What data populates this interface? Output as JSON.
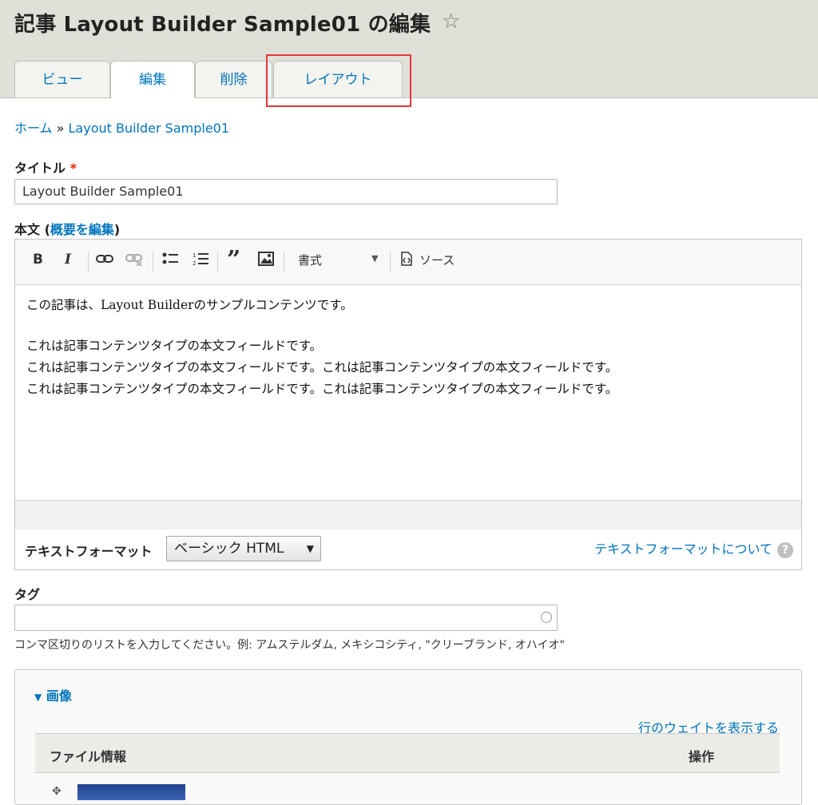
{
  "header": {
    "title": "記事 Layout Builder Sample01 の編集",
    "star_icon": "star-icon",
    "tabs": [
      {
        "label": "ビュー",
        "active": false
      },
      {
        "label": "編集",
        "active": true
      },
      {
        "label": "削除",
        "active": false
      },
      {
        "label": "レイアウト",
        "active": false,
        "highlighted": true
      }
    ],
    "highlight_color": "#e3393c"
  },
  "breadcrumb": {
    "home": "ホーム",
    "separator": "»",
    "current": "Layout Builder Sample01"
  },
  "title_field": {
    "label": "タイトル",
    "required_marker": "*",
    "value": "Layout Builder Sample01"
  },
  "body_field": {
    "label": "本文",
    "paren_open": "(",
    "summary_link": "概要を編集",
    "paren_close": ")",
    "toolbar": {
      "bold": "B",
      "italic": "I",
      "format_label": "書式",
      "source_label": "ソース"
    },
    "content": [
      "この記事は、Layout Builderのサンプルコンテンツです。",
      "これは記事コンテンツタイプの本文フィールドです。",
      "これは記事コンテンツタイプの本文フィールドです。これは記事コンテンツタイプの本文フィールドです。",
      "これは記事コンテンツタイプの本文フィールドです。これは記事コンテンツタイプの本文フィールドです。"
    ]
  },
  "text_format": {
    "label": "テキストフォーマット",
    "selected": "ベーシック HTML",
    "help_link": "テキストフォーマットについて",
    "help_icon_glyph": "?"
  },
  "tags_field": {
    "label": "タグ",
    "value": "",
    "description": "コンマ区切りのリストを入力してください。例: アムステルダム, メキシコシティ, \"クリーブランド, オハイオ\""
  },
  "image_section": {
    "summary": "画像",
    "weight_link": "行のウェイトを表示する",
    "columns": [
      "ファイル情報",
      "操作"
    ]
  },
  "colors": {
    "link": "#0074bd",
    "header_bg": "#e0e0d8",
    "required": "#e62600"
  }
}
